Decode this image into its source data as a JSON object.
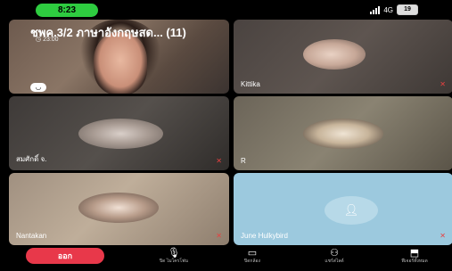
{
  "status_bar": {
    "time": "8:23",
    "network": "4G",
    "battery": "19"
  },
  "header": {
    "title": "ชพค.3/2 ภาษาอังกฤษสด... (11)",
    "elapsed": "23:00",
    "icons": [
      "screen-share-icon",
      "camera-switch-icon",
      "more-icon"
    ]
  },
  "tiles": [
    {
      "name": ""
    },
    {
      "name": "Kittika"
    },
    {
      "name": "สมศักดิ์ จ."
    },
    {
      "name": "R"
    },
    {
      "name": "Nantakan"
    },
    {
      "name": "June Hulkybird"
    }
  ],
  "controls": {
    "leave_label": "ออก",
    "items": [
      {
        "icon": "mic-icon",
        "label": "ปิด ไมโครโฟน"
      },
      {
        "icon": "camera-icon",
        "label": "ปิดกล้อง"
      },
      {
        "icon": "participants-icon",
        "label": "แชร์สไลด์"
      },
      {
        "icon": "share-icon",
        "label": "ฟีเจอร์ทั้งหมด"
      }
    ]
  },
  "colors": {
    "leave": "#e8384a",
    "time_pill": "#2ecc40",
    "muted": "#e84040"
  }
}
